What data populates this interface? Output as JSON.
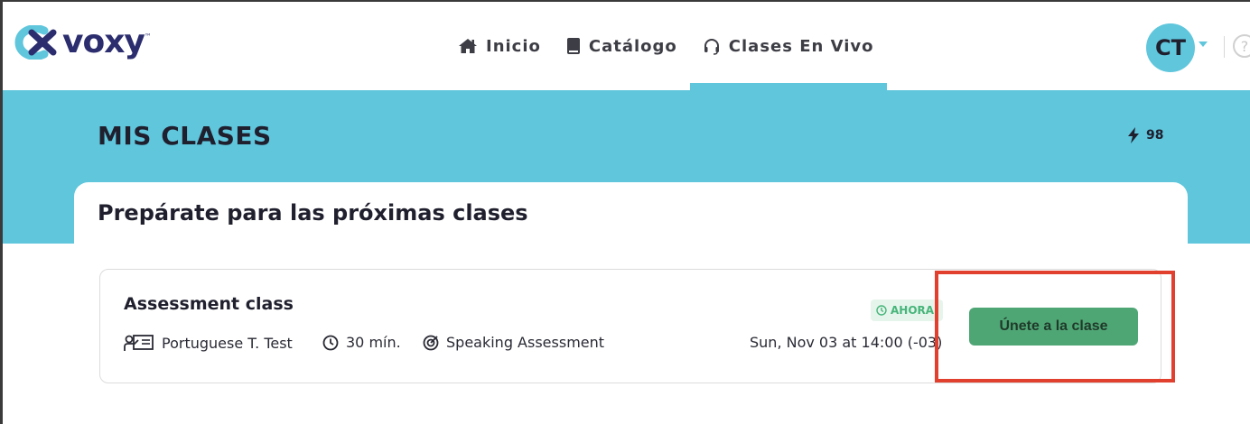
{
  "brand": {
    "name": "voxy",
    "tm": "™",
    "accent_color": "#5fc6dc",
    "dark_color": "#2b2d6e"
  },
  "nav": {
    "items": [
      {
        "label": "Inicio",
        "icon": "home-icon",
        "active": false
      },
      {
        "label": "Catálogo",
        "icon": "book-icon",
        "active": false
      },
      {
        "label": "Clases En Vivo",
        "icon": "headset-icon",
        "active": true
      }
    ]
  },
  "user": {
    "initials": "CT",
    "help_symbol": "?"
  },
  "page": {
    "title": "MIS CLASES",
    "points": "98"
  },
  "upcoming": {
    "section_title": "Prepárate para las próximas clases",
    "classes": [
      {
        "name": "Assessment class",
        "teacher": "Portuguese T. Test",
        "duration": "30 mín.",
        "type": "Speaking Assessment",
        "status_badge": "AHORA",
        "datetime": "Sun, Nov 03 at 14:00 (-03)",
        "join_label": "Únete a la clase",
        "join_color": "#4fa675"
      }
    ]
  },
  "highlight_color": "#e2402f"
}
